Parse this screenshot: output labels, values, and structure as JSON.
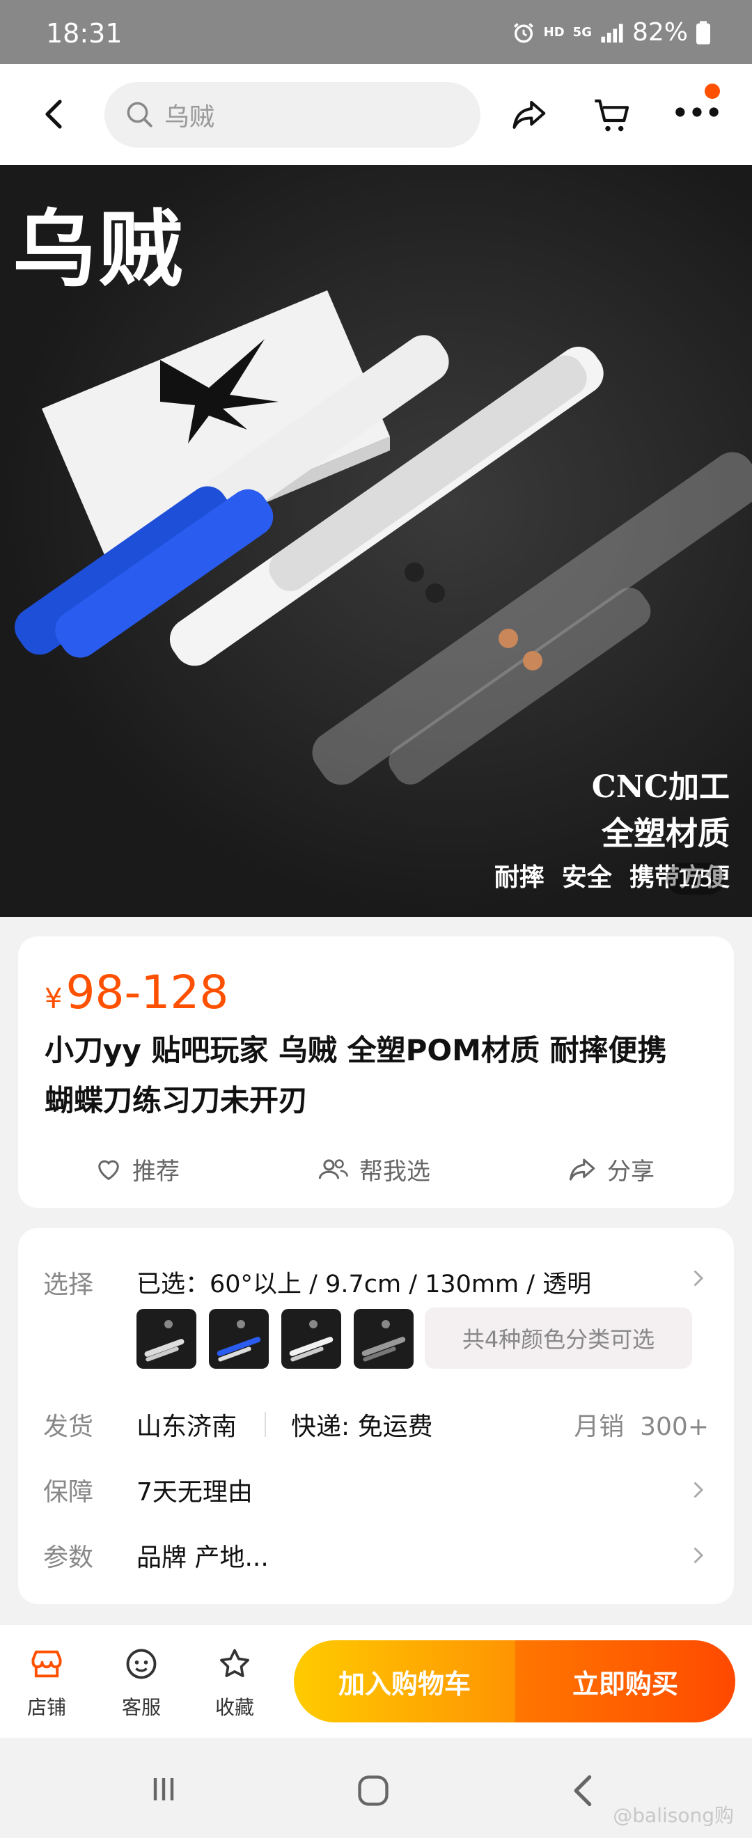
{
  "status_bar": {
    "time": "18:31",
    "hd": "HD",
    "net": "5G",
    "battery": "82%",
    "icons": [
      "alarm-icon",
      "signal-icon",
      "battery-icon"
    ]
  },
  "header": {
    "search_text": "乌贼",
    "icons": [
      "back-icon",
      "search-icon",
      "share-icon",
      "cart-icon",
      "more-icon"
    ],
    "notification_dot_color": "#ff5000"
  },
  "hero": {
    "title": "乌贼",
    "caption_lines": [
      "CNC加工",
      "全塑材质",
      "耐摔  安全  携带方便"
    ],
    "counter": "1/5"
  },
  "product": {
    "currency": "¥",
    "price": "98-128",
    "price_color": "#ff5000",
    "title_line1": "小刀yy 贴吧玩家 乌贼 全塑POM材质 耐摔便携",
    "title_line2": "蝴蝶刀练习刀未开刃",
    "actions": [
      {
        "label": "推荐",
        "icon": "heart-icon"
      },
      {
        "label": "帮我选",
        "icon": "people-icon"
      },
      {
        "label": "分享",
        "icon": "share-icon"
      }
    ]
  },
  "details": {
    "select_label": "选择",
    "select_value": "已选：60°以上 / 9.7cm / 130mm / 透明",
    "variant_count_text": "共4种颜色分类可选",
    "ship_label": "发货",
    "ship_origin": "山东济南",
    "ship_express": "快递: 免运费",
    "monthly_sales": "月销  300+",
    "guarantee_label": "保障",
    "guarantee_value": "7天无理由",
    "params_label": "参数",
    "params_value": "品牌 产地..."
  },
  "bottom_bar": {
    "store": "店铺",
    "service": "客服",
    "favorite": "收藏",
    "add_to_cart": "加入购物车",
    "buy_now": "立即购买"
  },
  "watermark": "@balisong购"
}
